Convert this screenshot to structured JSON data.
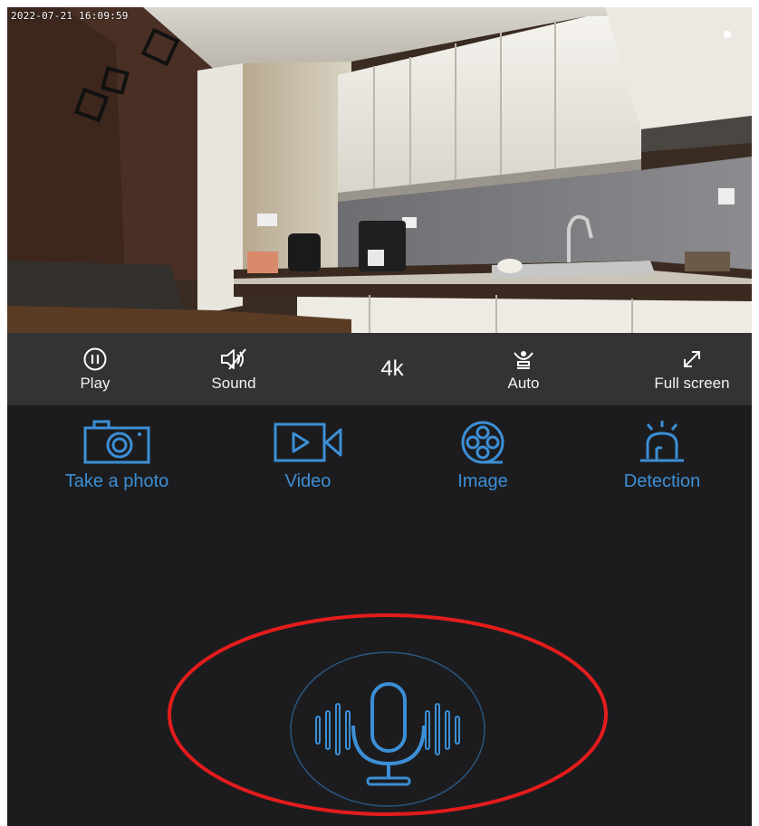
{
  "feed": {
    "timestamp": "2022-07-21 16:09:59"
  },
  "controls": [
    {
      "label": "Play",
      "icon": "pause-icon"
    },
    {
      "label": "Sound",
      "icon": "speaker-muted-icon"
    },
    {
      "label": "4k",
      "icon": ""
    },
    {
      "label": "Auto",
      "icon": "night-vision-icon"
    },
    {
      "label": "Full screen",
      "icon": "expand-icon"
    }
  ],
  "features": [
    {
      "label": "Take a photo",
      "icon": "camera-icon"
    },
    {
      "label": "Video",
      "icon": "video-icon"
    },
    {
      "label": "Image",
      "icon": "film-reel-icon"
    },
    {
      "label": "Detection",
      "icon": "alarm-light-icon"
    }
  ],
  "mic": {
    "icon": "microphone-icon"
  },
  "colors": {
    "accent": "#3c8fd6",
    "background": "#1c1c1e",
    "toolbar": "#333335",
    "annotation": "#e41c1c"
  }
}
